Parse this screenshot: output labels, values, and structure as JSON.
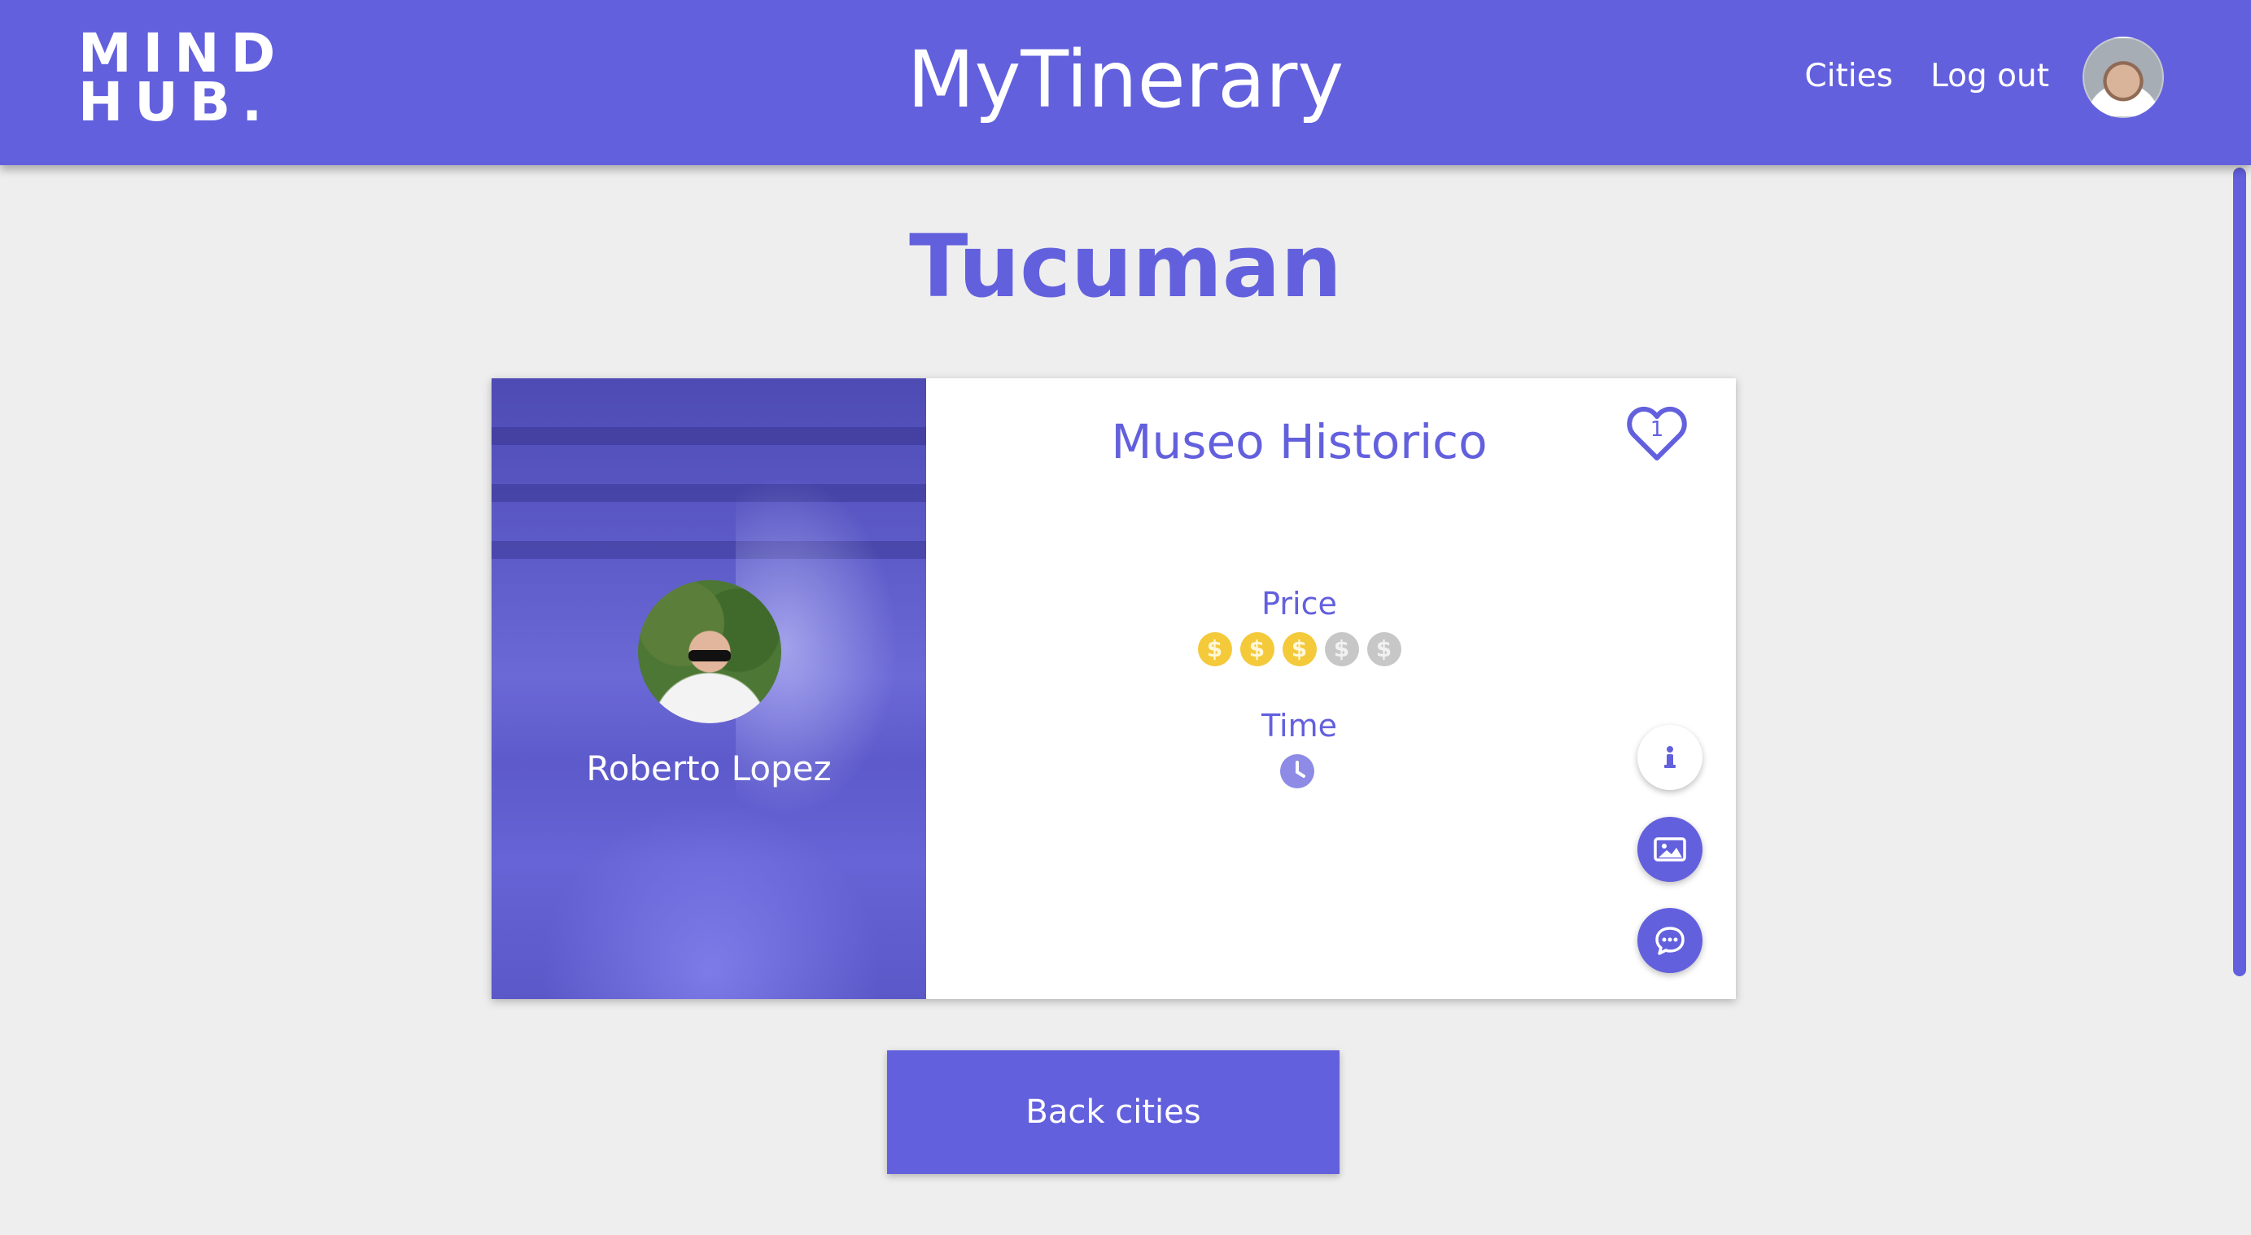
{
  "header": {
    "logo_line1": "MIND",
    "logo_line2": "HUB.",
    "title": "MyTinerary",
    "nav": {
      "cities": "Cities",
      "logout": "Log out"
    }
  },
  "page": {
    "city_name": "Tucuman",
    "back_button": "Back cities"
  },
  "itinerary": {
    "title": "Museo Historico",
    "likes": "1",
    "guide_name": "Roberto Lopez",
    "price_label": "Price",
    "price_level": 3,
    "price_max": 5,
    "price_symbol": "$",
    "time_label": "Time",
    "time_level": 1
  },
  "colors": {
    "primary": "#6360de",
    "coin_active": "#f4c93a",
    "coin_inactive": "#c7c7c7",
    "background": "#eeeeee"
  },
  "icons": {
    "like": "heart-icon",
    "time": "clock-icon",
    "info": "info-icon",
    "gallery": "image-icon",
    "comments": "chat-icon"
  }
}
